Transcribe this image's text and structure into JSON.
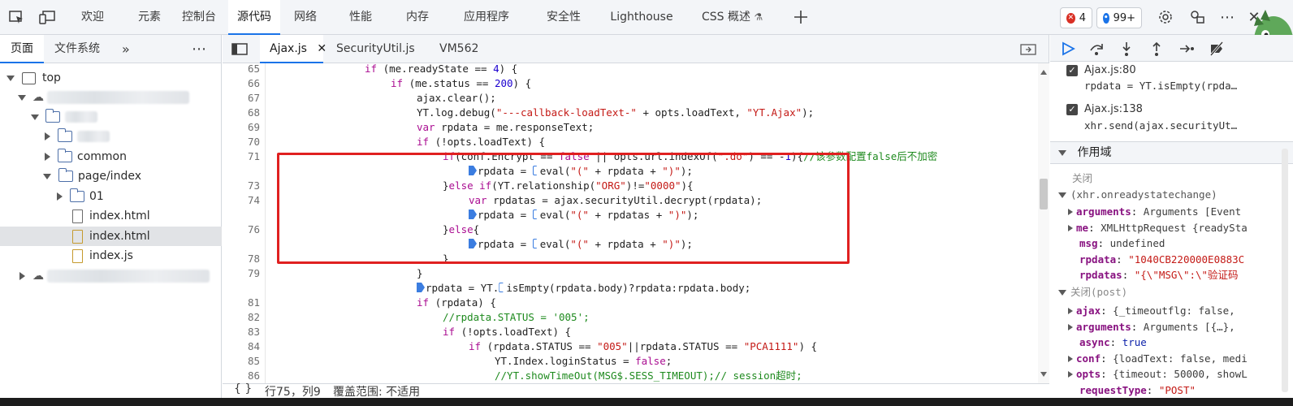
{
  "top_tabs": [
    {
      "label": "欢迎",
      "active": false
    },
    {
      "label": "元素",
      "active": false
    },
    {
      "label": "控制台",
      "active": false
    },
    {
      "label": "源代码",
      "active": true
    },
    {
      "label": "网络",
      "active": false
    },
    {
      "label": "性能",
      "active": false
    },
    {
      "label": "内存",
      "active": false
    },
    {
      "label": "应用程序",
      "active": false
    },
    {
      "label": "安全性",
      "active": false
    },
    {
      "label": "Lighthouse",
      "active": false
    },
    {
      "label": "CSS 概述",
      "active": false
    }
  ],
  "badges": {
    "errors": "4",
    "messages": "99+"
  },
  "left": {
    "tabs": [
      "页面",
      "文件系统"
    ],
    "tree": {
      "top": "top",
      "common": "common",
      "page_index": "page/index",
      "folder_01": "01",
      "file1": "index.html",
      "file2": "index.html",
      "file3": "index.js"
    }
  },
  "editor": {
    "tabs": [
      "Ajax.js",
      "SecurityUtil.js",
      "VM562"
    ],
    "lines": [
      {
        "n": "65",
        "bp": false,
        "html": "<span style='padding-left:119px'></span><span class='kw'>if</span> (me.readyState == <span class='nm'>4</span>) {"
      },
      {
        "n": "66",
        "bp": false,
        "html": "<span style='padding-left:151px'></span><span class='kw'>if</span> (me.status == <span class='nm'>200</span>) {"
      },
      {
        "n": "67",
        "bp": false,
        "html": "<span style='padding-left:183px'></span>ajax.clear();"
      },
      {
        "n": "68",
        "bp": false,
        "html": "<span style='padding-left:183px'></span>YT.log.debug(<span class='st'>\"---callback-loadText-\"</span> + opts.loadText, <span class='st'>\"YT.Ajax\"</span>);"
      },
      {
        "n": "69",
        "bp": false,
        "html": "<span style='padding-left:183px'></span><span class='kw'>var</span> rpdata = me.responseText;"
      },
      {
        "n": "70",
        "bp": false,
        "html": "<span style='padding-left:183px'></span><span class='kw'>if</span> (!opts.loadText) {"
      },
      {
        "n": "71",
        "bp": false,
        "html": "<span style='padding-left:215px'></span><span class='kw'>if</span>(conf.Encrypt == <span class='kw'>false</span> || opts.url.indexOf(<span class='st'>\".do\"</span>) == -<span class='nm'>1</span>){<span class='cm'>//该参数配置false后不加密</span>"
      },
      {
        "n": "72",
        "bp": true,
        "html": "<span style='padding-left:247px'></span><span class='mk'></span>rpdata = <span class='mk hollow'></span>eval(<span class='st'>\"(\"</span> + rpdata + <span class='st'>\")\"</span>);"
      },
      {
        "n": "73",
        "bp": false,
        "html": "<span style='padding-left:215px'></span>}<span class='kw'>else if</span>(YT.relationship(<span class='st'>\"ORG\"</span>)!=<span class='st'>\"0000\"</span>){"
      },
      {
        "n": "74",
        "bp": false,
        "html": "<span style='padding-left:247px'></span><span class='kw'>var</span> rpdatas = ajax.securityUtil.decrypt(rpdata);"
      },
      {
        "n": "75",
        "bp": true,
        "html": "<span style='padding-left:247px'></span><span class='mk'></span>rpdata = <span class='mk hollow'></span>eval(<span class='st'>\"(\"</span> + rpdatas + <span class='st'>\")\"</span>);"
      },
      {
        "n": "76",
        "bp": false,
        "html": "<span style='padding-left:215px'></span>}<span class='kw'>else</span>{"
      },
      {
        "n": "77",
        "bp": true,
        "html": "<span style='padding-left:247px'></span><span class='mk'></span>rpdata = <span class='mk hollow'></span>eval(<span class='st'>\"(\"</span> + rpdata + <span class='st'>\")\"</span>);"
      },
      {
        "n": "78",
        "bp": false,
        "html": "<span style='padding-left:215px'></span>}"
      },
      {
        "n": "79",
        "bp": false,
        "html": "<span style='padding-left:183px'></span>}"
      },
      {
        "n": "80",
        "bp": true,
        "html": "<span style='padding-left:183px'></span><span class='mk'></span>rpdata = YT.<span class='mk hollow'></span>isEmpty(rpdata.body)?rpdata:rpdata.body;"
      },
      {
        "n": "81",
        "bp": false,
        "html": "<span style='padding-left:183px'></span><span class='kw'>if</span> (rpdata) {"
      },
      {
        "n": "82",
        "bp": false,
        "html": "<span style='padding-left:215px'></span><span class='cm'>//rpdata.STATUS = '005';</span>"
      },
      {
        "n": "83",
        "bp": false,
        "html": "<span style='padding-left:215px'></span><span class='kw'>if</span> (!opts.loadText) {"
      },
      {
        "n": "84",
        "bp": false,
        "html": "<span style='padding-left:247px'></span><span class='kw'>if</span> (rpdata.STATUS == <span class='st'>\"005\"</span>||rpdata.STATUS == <span class='st'>\"PCA1111\"</span>) {"
      },
      {
        "n": "85",
        "bp": false,
        "html": "<span style='padding-left:279px'></span>YT.Index.loginStatus = <span class='kw'>false</span>;"
      },
      {
        "n": "86",
        "bp": false,
        "html": "<span style='padding-left:279px'></span><span class='cm'>//YT.showTimeOut(MSG$.SESS_TIMEOUT);// session超时;</span>"
      }
    ],
    "status": {
      "braces": "{ }",
      "position": "行75，列9",
      "coverage": "覆盖范围: 不适用"
    }
  },
  "right": {
    "breakpoints": [
      {
        "file": "Ajax.js:80",
        "code": "rpdata = YT.isEmpty(rpda…"
      },
      {
        "file": "Ajax.js:138",
        "code": "xhr.send(ajax.securityUt…"
      }
    ],
    "scope_title": "作用域",
    "closure1": {
      "title": "关闭",
      "subtitle": "(xhr.onreadystatechange)"
    },
    "scope1": [
      {
        "k": "arguments",
        "v": "Arguments [Event",
        "exp": true,
        "cls": "gv"
      },
      {
        "k": "me",
        "v": "XMLHttpRequest {readySta",
        "exp": true,
        "cls": "gv"
      },
      {
        "k": "msg",
        "v": "undefined",
        "exp": false,
        "cls": "gv"
      },
      {
        "k": "rpdata",
        "v": "\"1040CB220000E0883C",
        "exp": false,
        "cls": "sv"
      },
      {
        "k": "rpdatas",
        "v": "\"{\\\"MSG\\\":\\\"验证码",
        "exp": false,
        "cls": "sv"
      }
    ],
    "closure2": {
      "title": "关闭(post)"
    },
    "scope2": [
      {
        "k": "ajax",
        "v": "{_timeoutflg: false, ",
        "exp": true,
        "cls": "gv"
      },
      {
        "k": "arguments",
        "v": "Arguments [{…}, ",
        "exp": true,
        "cls": "gv"
      },
      {
        "k": "async",
        "v": "true",
        "exp": false,
        "cls": "bv"
      },
      {
        "k": "conf",
        "v": "{loadText: false, medi",
        "exp": true,
        "cls": "gv"
      },
      {
        "k": "opts",
        "v": "{timeout: 50000, showL",
        "exp": true,
        "cls": "gv"
      },
      {
        "k": "requestType",
        "v": "\"POST\"",
        "exp": false,
        "cls": "sv"
      }
    ]
  }
}
